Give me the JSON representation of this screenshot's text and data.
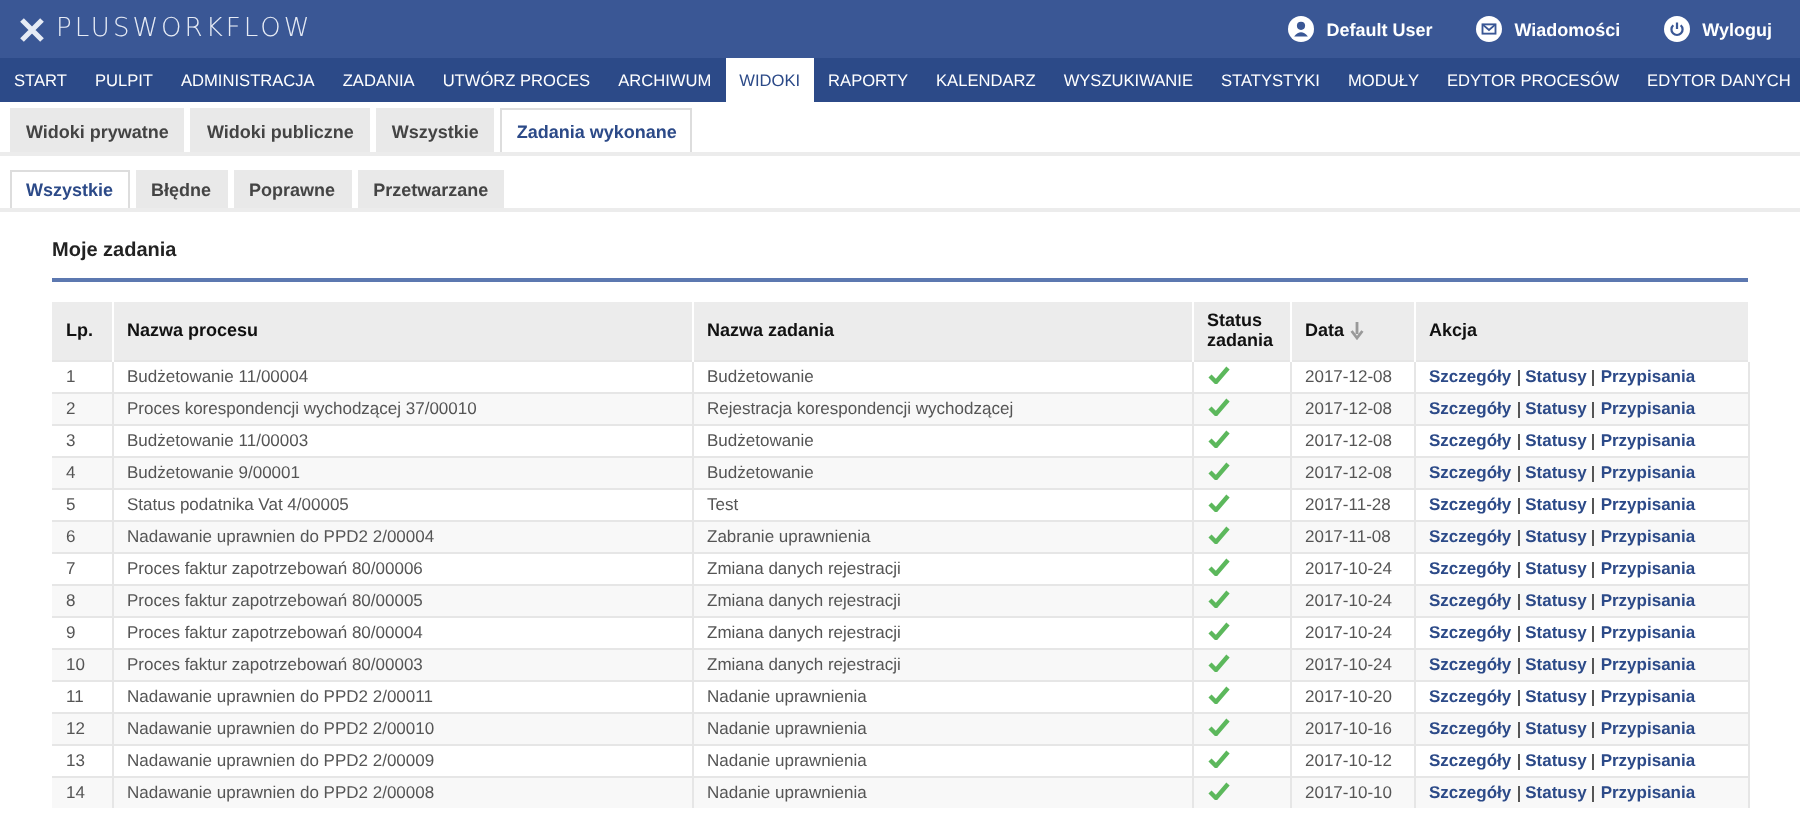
{
  "header": {
    "logo": "PLUSWORKFLOW",
    "user_menu": [
      {
        "kind": "user",
        "label": "Default User"
      },
      {
        "kind": "messages",
        "label": "Wiadomości"
      },
      {
        "kind": "logout",
        "label": "Wyloguj"
      }
    ]
  },
  "nav": [
    {
      "label": "START",
      "selected": false
    },
    {
      "label": "PULPIT",
      "selected": false
    },
    {
      "label": "ADMINISTRACJA",
      "selected": false
    },
    {
      "label": "ZADANIA",
      "selected": false
    },
    {
      "label": "UTWÓRZ PROCES",
      "selected": false
    },
    {
      "label": "ARCHIWUM",
      "selected": false
    },
    {
      "label": "WIDOKI",
      "selected": true
    },
    {
      "label": "RAPORTY",
      "selected": false
    },
    {
      "label": "KALENDARZ",
      "selected": false
    },
    {
      "label": "WYSZUKIWANIE",
      "selected": false
    },
    {
      "label": "STATYSTYKI",
      "selected": false
    },
    {
      "label": "MODUŁY",
      "selected": false
    },
    {
      "label": "EDYTOR PROCESÓW",
      "selected": false
    },
    {
      "label": "EDYTOR DANYCH",
      "selected": false
    }
  ],
  "view_tabs": [
    {
      "label": "Widoki prywatne",
      "selected": false
    },
    {
      "label": "Widoki publiczne",
      "selected": false
    },
    {
      "label": "Wszystkie",
      "selected": false
    },
    {
      "label": "Zadania wykonane",
      "selected": true
    }
  ],
  "filter_tabs": [
    {
      "label": "Wszystkie",
      "selected": true
    },
    {
      "label": "Błędne",
      "selected": false
    },
    {
      "label": "Poprawne",
      "selected": false
    },
    {
      "label": "Przetwarzane",
      "selected": false
    }
  ],
  "section_title": "Moje zadania",
  "table": {
    "columns": [
      {
        "label": "Lp.",
        "sorted": false
      },
      {
        "label": "Nazwa procesu",
        "sorted": false
      },
      {
        "label": "Nazwa zadania",
        "sorted": false
      },
      {
        "label": "Status zadania",
        "sorted": false
      },
      {
        "label": "Data",
        "sorted": true
      },
      {
        "label": "Akcja",
        "sorted": false
      }
    ],
    "rows": [
      {
        "lp": "1",
        "process": "Budżetowanie 11/00004",
        "task": "Budżetowanie",
        "done": true,
        "date": "2017-12-08",
        "actions": [
          "Szczegóły",
          "Statusy",
          "Przypisania"
        ]
      },
      {
        "lp": "2",
        "process": "Proces korespondencji wychodzącej 37/00010",
        "task": "Rejestracja korespondencji wychodzącej",
        "done": true,
        "date": "2017-12-08",
        "actions": [
          "Szczegóły",
          "Statusy",
          "Przypisania"
        ]
      },
      {
        "lp": "3",
        "process": "Budżetowanie 11/00003",
        "task": "Budżetowanie",
        "done": true,
        "date": "2017-12-08",
        "actions": [
          "Szczegóły",
          "Statusy",
          "Przypisania"
        ]
      },
      {
        "lp": "4",
        "process": "Budżetowanie 9/00001",
        "task": "Budżetowanie",
        "done": true,
        "date": "2017-12-08",
        "actions": [
          "Szczegóły",
          "Statusy",
          "Przypisania"
        ]
      },
      {
        "lp": "5",
        "process": "Status podatnika Vat 4/00005",
        "task": "Test",
        "done": true,
        "date": "2017-11-28",
        "actions": [
          "Szczegóły",
          "Statusy",
          "Przypisania"
        ]
      },
      {
        "lp": "6",
        "process": "Nadawanie uprawnien do PPD2 2/00004",
        "task": "Zabranie uprawnienia",
        "done": true,
        "date": "2017-11-08",
        "actions": [
          "Szczegóły",
          "Statusy",
          "Przypisania"
        ]
      },
      {
        "lp": "7",
        "process": "Proces faktur zapotrzebowań 80/00006",
        "task": "Zmiana danych rejestracji",
        "done": true,
        "date": "2017-10-24",
        "actions": [
          "Szczegóły",
          "Statusy",
          "Przypisania"
        ]
      },
      {
        "lp": "8",
        "process": "Proces faktur zapotrzebowań 80/00005",
        "task": "Zmiana danych rejestracji",
        "done": true,
        "date": "2017-10-24",
        "actions": [
          "Szczegóły",
          "Statusy",
          "Przypisania"
        ]
      },
      {
        "lp": "9",
        "process": "Proces faktur zapotrzebowań 80/00004",
        "task": "Zmiana danych rejestracji",
        "done": true,
        "date": "2017-10-24",
        "actions": [
          "Szczegóły",
          "Statusy",
          "Przypisania"
        ]
      },
      {
        "lp": "10",
        "process": "Proces faktur zapotrzebowań 80/00003",
        "task": "Zmiana danych rejestracji",
        "done": true,
        "date": "2017-10-24",
        "actions": [
          "Szczegóły",
          "Statusy",
          "Przypisania"
        ]
      },
      {
        "lp": "11",
        "process": "Nadawanie uprawnien do PPD2 2/00011",
        "task": "Nadanie uprawnienia",
        "done": true,
        "date": "2017-10-20",
        "actions": [
          "Szczegóły",
          "Statusy",
          "Przypisania"
        ]
      },
      {
        "lp": "12",
        "process": "Nadawanie uprawnien do PPD2 2/00010",
        "task": "Nadanie uprawnienia",
        "done": true,
        "date": "2017-10-16",
        "actions": [
          "Szczegóły",
          "Statusy",
          "Przypisania"
        ]
      },
      {
        "lp": "13",
        "process": "Nadawanie uprawnien do PPD2 2/00009",
        "task": "Nadanie uprawnienia",
        "done": true,
        "date": "2017-10-12",
        "actions": [
          "Szczegóły",
          "Statusy",
          "Przypisania"
        ]
      },
      {
        "lp": "14",
        "process": "Nadawanie uprawnien do PPD2 2/00008",
        "task": "Nadanie uprawnienia",
        "done": true,
        "date": "2017-10-10",
        "actions": [
          "Szczegóły",
          "Statusy",
          "Przypisania"
        ]
      }
    ]
  }
}
